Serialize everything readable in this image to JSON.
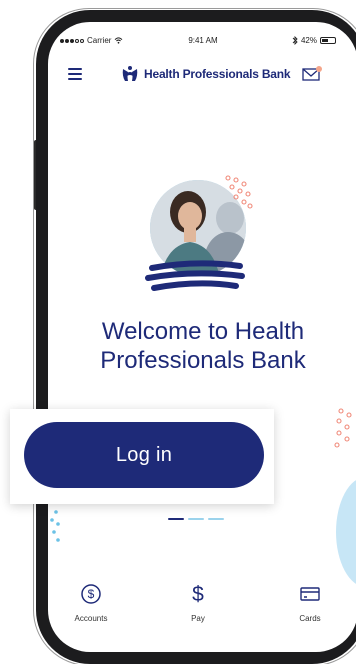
{
  "status_bar": {
    "carrier": "Carrier",
    "time": "9:41 AM",
    "battery": "42%"
  },
  "header": {
    "brand_name": "Health Professionals Bank",
    "icons": [
      "menu-icon",
      "logo-icon",
      "mail-icon"
    ]
  },
  "welcome": {
    "line1": "Welcome to Health",
    "line2": "Professionals Bank"
  },
  "login": {
    "label": "Log in"
  },
  "pager": {
    "count": 3,
    "active_index": 0
  },
  "tabbar": {
    "items": [
      {
        "label": "Accounts",
        "icon": "dollar-circle-icon"
      },
      {
        "label": "Pay",
        "icon": "dollar-icon"
      },
      {
        "label": "Cards",
        "icon": "card-icon"
      }
    ]
  },
  "colors": {
    "brand": "#1e2a78",
    "accent_light": "#9bd3ec",
    "accent_coral": "#f08a7a",
    "notification_dot": "#f4a58a"
  }
}
